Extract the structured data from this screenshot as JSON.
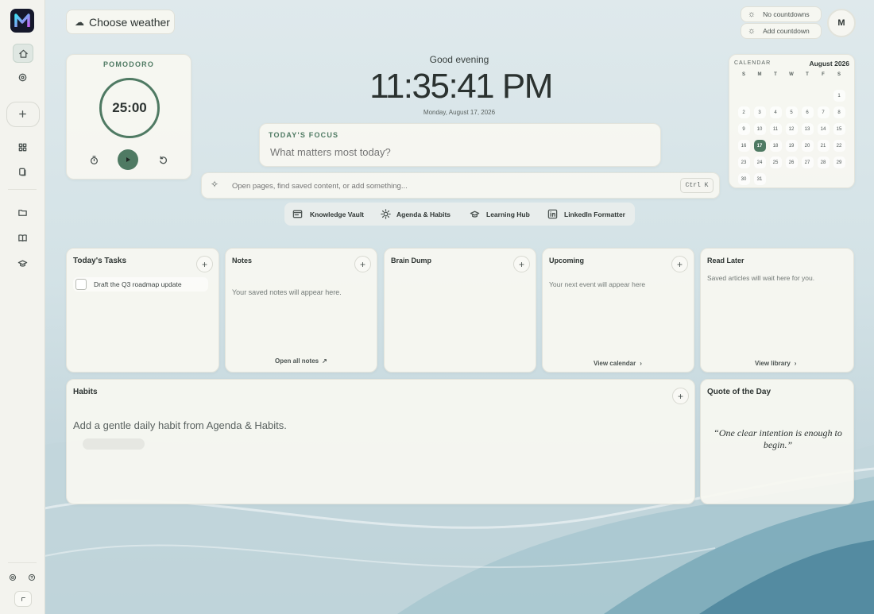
{
  "weather_button": {
    "label": "Choose weather"
  },
  "countdowns": {
    "status": "No countdowns",
    "add_label": "Add countdown"
  },
  "avatar": {
    "initial": "M"
  },
  "pomodoro": {
    "title": "POMODORO",
    "time": "25:00"
  },
  "clock": {
    "greeting": "Good evening",
    "time": "11:35:41 PM",
    "date": "Monday, August 17, 2026"
  },
  "focus": {
    "label": "TODAY'S FOCUS",
    "placeholder": "What matters most today?"
  },
  "search": {
    "placeholder": "Open pages, find saved content, or add something...",
    "shortcut": "Ctrl K"
  },
  "quick_links": [
    {
      "label": "Knowledge Vault",
      "icon": "card-icon"
    },
    {
      "label": "Agenda & Habits",
      "icon": "sun-icon"
    },
    {
      "label": "Learning Hub",
      "icon": "graduation-cap-icon"
    },
    {
      "label": "LinkedIn Formatter",
      "icon": "linkedin-icon"
    }
  ],
  "calendar": {
    "label": "CALENDAR",
    "month": "August 2026",
    "weekdays": [
      "S",
      "M",
      "T",
      "W",
      "T",
      "F",
      "S"
    ],
    "weeks": [
      [
        "",
        "",
        "",
        "",
        "",
        "",
        "1"
      ],
      [
        "2",
        "3",
        "4",
        "5",
        "6",
        "7",
        "8"
      ],
      [
        "9",
        "10",
        "11",
        "12",
        "13",
        "14",
        "15"
      ],
      [
        "16",
        "17",
        "18",
        "19",
        "20",
        "21",
        "22"
      ],
      [
        "23",
        "24",
        "25",
        "26",
        "27",
        "28",
        "29"
      ],
      [
        "30",
        "31",
        "",
        "",
        "",
        "",
        ""
      ]
    ],
    "today": "17"
  },
  "tasks": {
    "title": "Today's Tasks",
    "items": [
      "Draft the Q3 roadmap update"
    ]
  },
  "notes": {
    "title": "Notes",
    "empty": "Your saved notes will appear here.",
    "link": "Open all notes"
  },
  "brain_dump": {
    "title": "Brain Dump"
  },
  "upcoming": {
    "title": "Upcoming",
    "empty": "Your next event will appear here",
    "link": "View calendar"
  },
  "read_later": {
    "title": "Read Later",
    "empty": "Saved articles will wait here for you.",
    "link": "View library"
  },
  "habits": {
    "title": "Habits",
    "empty": "Add a gentle daily habit from Agenda & Habits."
  },
  "quote": {
    "title": "Quote of the Day",
    "text": "“One clear intention is enough to begin.”"
  },
  "colors": {
    "accent": "#4f7a63",
    "card": "#f7f7f1",
    "rail": "#f3f3ee"
  }
}
